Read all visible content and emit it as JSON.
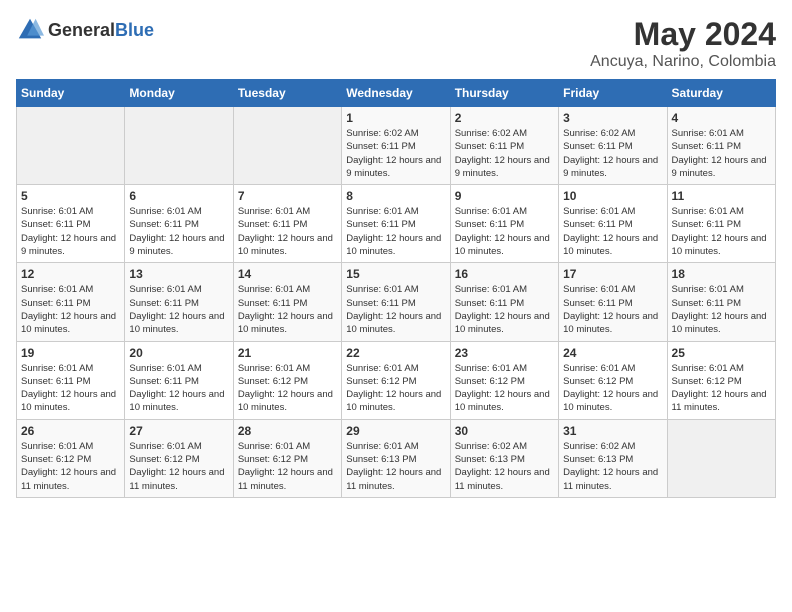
{
  "logo": {
    "general": "General",
    "blue": "Blue"
  },
  "title": "May 2024",
  "subtitle": "Ancuya, Narino, Colombia",
  "weekdays": [
    "Sunday",
    "Monday",
    "Tuesday",
    "Wednesday",
    "Thursday",
    "Friday",
    "Saturday"
  ],
  "weeks": [
    [
      {
        "day": "",
        "empty": true
      },
      {
        "day": "",
        "empty": true
      },
      {
        "day": "",
        "empty": true
      },
      {
        "day": "1",
        "sunrise": "Sunrise: 6:02 AM",
        "sunset": "Sunset: 6:11 PM",
        "daylight": "Daylight: 12 hours and 9 minutes."
      },
      {
        "day": "2",
        "sunrise": "Sunrise: 6:02 AM",
        "sunset": "Sunset: 6:11 PM",
        "daylight": "Daylight: 12 hours and 9 minutes."
      },
      {
        "day": "3",
        "sunrise": "Sunrise: 6:02 AM",
        "sunset": "Sunset: 6:11 PM",
        "daylight": "Daylight: 12 hours and 9 minutes."
      },
      {
        "day": "4",
        "sunrise": "Sunrise: 6:01 AM",
        "sunset": "Sunset: 6:11 PM",
        "daylight": "Daylight: 12 hours and 9 minutes."
      }
    ],
    [
      {
        "day": "5",
        "sunrise": "Sunrise: 6:01 AM",
        "sunset": "Sunset: 6:11 PM",
        "daylight": "Daylight: 12 hours and 9 minutes."
      },
      {
        "day": "6",
        "sunrise": "Sunrise: 6:01 AM",
        "sunset": "Sunset: 6:11 PM",
        "daylight": "Daylight: 12 hours and 9 minutes."
      },
      {
        "day": "7",
        "sunrise": "Sunrise: 6:01 AM",
        "sunset": "Sunset: 6:11 PM",
        "daylight": "Daylight: 12 hours and 10 minutes."
      },
      {
        "day": "8",
        "sunrise": "Sunrise: 6:01 AM",
        "sunset": "Sunset: 6:11 PM",
        "daylight": "Daylight: 12 hours and 10 minutes."
      },
      {
        "day": "9",
        "sunrise": "Sunrise: 6:01 AM",
        "sunset": "Sunset: 6:11 PM",
        "daylight": "Daylight: 12 hours and 10 minutes."
      },
      {
        "day": "10",
        "sunrise": "Sunrise: 6:01 AM",
        "sunset": "Sunset: 6:11 PM",
        "daylight": "Daylight: 12 hours and 10 minutes."
      },
      {
        "day": "11",
        "sunrise": "Sunrise: 6:01 AM",
        "sunset": "Sunset: 6:11 PM",
        "daylight": "Daylight: 12 hours and 10 minutes."
      }
    ],
    [
      {
        "day": "12",
        "sunrise": "Sunrise: 6:01 AM",
        "sunset": "Sunset: 6:11 PM",
        "daylight": "Daylight: 12 hours and 10 minutes."
      },
      {
        "day": "13",
        "sunrise": "Sunrise: 6:01 AM",
        "sunset": "Sunset: 6:11 PM",
        "daylight": "Daylight: 12 hours and 10 minutes."
      },
      {
        "day": "14",
        "sunrise": "Sunrise: 6:01 AM",
        "sunset": "Sunset: 6:11 PM",
        "daylight": "Daylight: 12 hours and 10 minutes."
      },
      {
        "day": "15",
        "sunrise": "Sunrise: 6:01 AM",
        "sunset": "Sunset: 6:11 PM",
        "daylight": "Daylight: 12 hours and 10 minutes."
      },
      {
        "day": "16",
        "sunrise": "Sunrise: 6:01 AM",
        "sunset": "Sunset: 6:11 PM",
        "daylight": "Daylight: 12 hours and 10 minutes."
      },
      {
        "day": "17",
        "sunrise": "Sunrise: 6:01 AM",
        "sunset": "Sunset: 6:11 PM",
        "daylight": "Daylight: 12 hours and 10 minutes."
      },
      {
        "day": "18",
        "sunrise": "Sunrise: 6:01 AM",
        "sunset": "Sunset: 6:11 PM",
        "daylight": "Daylight: 12 hours and 10 minutes."
      }
    ],
    [
      {
        "day": "19",
        "sunrise": "Sunrise: 6:01 AM",
        "sunset": "Sunset: 6:11 PM",
        "daylight": "Daylight: 12 hours and 10 minutes."
      },
      {
        "day": "20",
        "sunrise": "Sunrise: 6:01 AM",
        "sunset": "Sunset: 6:11 PM",
        "daylight": "Daylight: 12 hours and 10 minutes."
      },
      {
        "day": "21",
        "sunrise": "Sunrise: 6:01 AM",
        "sunset": "Sunset: 6:12 PM",
        "daylight": "Daylight: 12 hours and 10 minutes."
      },
      {
        "day": "22",
        "sunrise": "Sunrise: 6:01 AM",
        "sunset": "Sunset: 6:12 PM",
        "daylight": "Daylight: 12 hours and 10 minutes."
      },
      {
        "day": "23",
        "sunrise": "Sunrise: 6:01 AM",
        "sunset": "Sunset: 6:12 PM",
        "daylight": "Daylight: 12 hours and 10 minutes."
      },
      {
        "day": "24",
        "sunrise": "Sunrise: 6:01 AM",
        "sunset": "Sunset: 6:12 PM",
        "daylight": "Daylight: 12 hours and 10 minutes."
      },
      {
        "day": "25",
        "sunrise": "Sunrise: 6:01 AM",
        "sunset": "Sunset: 6:12 PM",
        "daylight": "Daylight: 12 hours and 11 minutes."
      }
    ],
    [
      {
        "day": "26",
        "sunrise": "Sunrise: 6:01 AM",
        "sunset": "Sunset: 6:12 PM",
        "daylight": "Daylight: 12 hours and 11 minutes."
      },
      {
        "day": "27",
        "sunrise": "Sunrise: 6:01 AM",
        "sunset": "Sunset: 6:12 PM",
        "daylight": "Daylight: 12 hours and 11 minutes."
      },
      {
        "day": "28",
        "sunrise": "Sunrise: 6:01 AM",
        "sunset": "Sunset: 6:12 PM",
        "daylight": "Daylight: 12 hours and 11 minutes."
      },
      {
        "day": "29",
        "sunrise": "Sunrise: 6:01 AM",
        "sunset": "Sunset: 6:13 PM",
        "daylight": "Daylight: 12 hours and 11 minutes."
      },
      {
        "day": "30",
        "sunrise": "Sunrise: 6:02 AM",
        "sunset": "Sunset: 6:13 PM",
        "daylight": "Daylight: 12 hours and 11 minutes."
      },
      {
        "day": "31",
        "sunrise": "Sunrise: 6:02 AM",
        "sunset": "Sunset: 6:13 PM",
        "daylight": "Daylight: 12 hours and 11 minutes."
      },
      {
        "day": "",
        "empty": true
      }
    ]
  ]
}
